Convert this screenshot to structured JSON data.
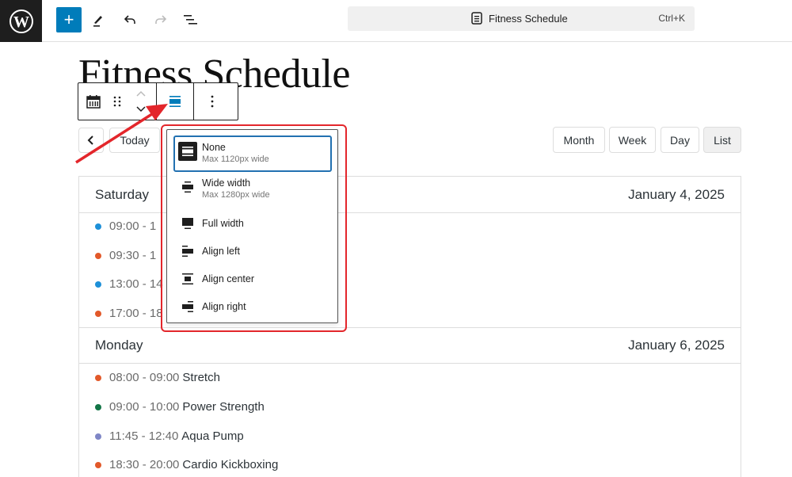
{
  "topbar": {
    "logo": "wordpress-logo",
    "add_label": "+",
    "command_bar": {
      "title": "Fitness Schedule",
      "shortcut": "Ctrl+K"
    }
  },
  "page": {
    "title": "Fitness Schedule"
  },
  "calendar": {
    "nav": {
      "prev": "<",
      "today": "Today"
    },
    "views": [
      {
        "label": "Month",
        "active": false
      },
      {
        "label": "Week",
        "active": false
      },
      {
        "label": "Day",
        "active": false
      },
      {
        "label": "List",
        "active": true
      }
    ],
    "days": [
      {
        "day": "Saturday",
        "date": "January 4, 2025",
        "events": [
          {
            "time": "09:00 - 1",
            "title": "",
            "color": "#1e90d8"
          },
          {
            "time": "09:30 - 1",
            "title": "",
            "color": "#e2592a"
          },
          {
            "time": "13:00 - 14",
            "title": "",
            "color": "#1e90d8"
          },
          {
            "time": "17:00 - 18",
            "title": "",
            "color": "#e2592a"
          }
        ]
      },
      {
        "day": "Monday",
        "date": "January 6, 2025",
        "events": [
          {
            "time": "08:00 - 09:00",
            "title": "Stretch",
            "color": "#e2592a"
          },
          {
            "time": "09:00 - 10:00",
            "title": "Power Strength",
            "color": "#137547"
          },
          {
            "time": "11:45 - 12:40",
            "title": "Aqua Pump",
            "color": "#7f86c6"
          },
          {
            "time": "18:30 - 20:00",
            "title": "Cardio Kickboxing",
            "color": "#e2592a"
          }
        ]
      }
    ]
  },
  "align_menu": {
    "items": [
      {
        "label": "None",
        "sub": "Max 1120px wide",
        "icon": "align-none-icon",
        "selected": true
      },
      {
        "label": "Wide width",
        "sub": "Max 1280px wide",
        "icon": "align-wide-icon",
        "selected": false
      },
      {
        "label": "Full width",
        "sub": "",
        "icon": "align-full-icon",
        "selected": false
      },
      {
        "label": "Align left",
        "sub": "",
        "icon": "align-left-icon",
        "selected": false
      },
      {
        "label": "Align center",
        "sub": "",
        "icon": "align-center-icon",
        "selected": false
      },
      {
        "label": "Align right",
        "sub": "",
        "icon": "align-right-icon",
        "selected": false
      }
    ]
  },
  "colors": {
    "accent": "#007cba",
    "annotation": "#e3262b"
  }
}
